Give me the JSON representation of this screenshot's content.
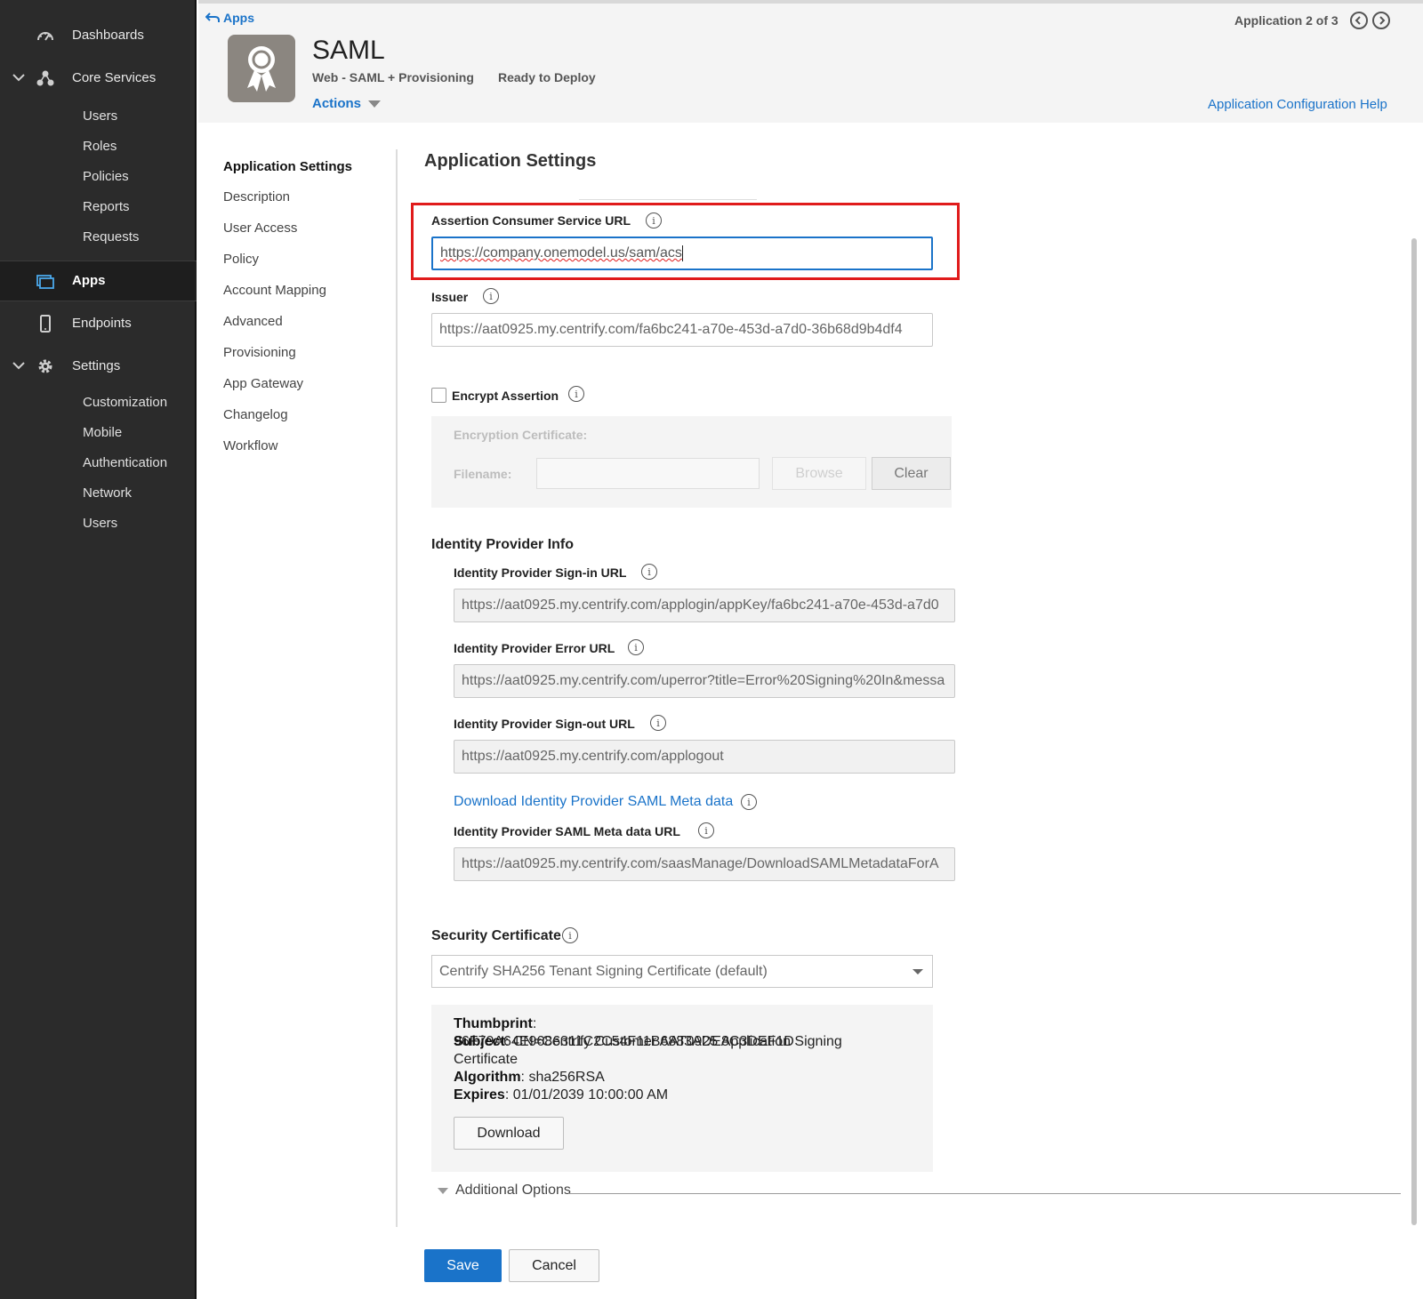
{
  "sidebar": {
    "dashboards": "Dashboards",
    "core_services": "Core Services",
    "core_items": [
      "Users",
      "Roles",
      "Policies",
      "Reports",
      "Requests"
    ],
    "apps": "Apps",
    "endpoints": "Endpoints",
    "settings": "Settings",
    "settings_items": [
      "Customization",
      "Mobile",
      "Authentication",
      "Network",
      "Users"
    ]
  },
  "header": {
    "back_label": "Apps",
    "app_name": "SAML",
    "app_type": "Web - SAML + Provisioning",
    "status": "Ready to Deploy",
    "actions_label": "Actions",
    "counter": "Application 2 of 3",
    "config_help": "Application Configuration Help"
  },
  "section_nav": [
    "Application Settings",
    "Description",
    "User Access",
    "Policy",
    "Account Mapping",
    "Advanced",
    "Provisioning",
    "App Gateway",
    "Changelog",
    "Workflow"
  ],
  "form": {
    "title": "Application Settings",
    "acs_label": "Assertion Consumer Service URL",
    "acs_value": "https://company.onemodel.us/sam/acs",
    "issuer_label": "Issuer",
    "issuer_value": "https://aat0925.my.centrify.com/fa6bc241-a70e-453d-a7d0-36b68d9b4df4",
    "encrypt_label": "Encrypt Assertion",
    "encrypt_checked": false,
    "enc_cert_label": "Encryption Certificate:",
    "filename_label": "Filename:",
    "browse_label": "Browse",
    "clear_label": "Clear",
    "idp_heading": "Identity Provider Info",
    "signin_label": "Identity Provider Sign-in URL",
    "signin_value": "https://aat0925.my.centrify.com/applogin/appKey/fa6bc241-a70e-453d-a7d0",
    "error_label": "Identity Provider Error URL",
    "error_value": "https://aat0925.my.centrify.com/uperror?title=Error%20Signing%20In&messa",
    "signout_label": "Identity Provider Sign-out URL",
    "signout_value": "https://aat0925.my.centrify.com/applogout",
    "download_meta_link": "Download Identity Provider SAML Meta data",
    "meta_url_label": "Identity Provider SAML Meta data URL",
    "meta_url_value": "https://aat0925.my.centrify.com/saasManage/DownloadSAMLMetadataForA",
    "cert_heading": "Security Certificate",
    "cert_select": "Centrify SHA256 Tenant Signing Certificate (default)",
    "thumbprint_label": "Thumbprint",
    "thumbprint_value": "96F79A64E9686311C2C54F11B6883ADE8C3DEF1D",
    "subject_label": "Subject",
    "subject_value": "CN=Centrify Customer AAT0925 Application Signing Certificate",
    "algorithm_label": "Algorithm",
    "algorithm_value": "sha256RSA",
    "expires_label": "Expires",
    "expires_value": "01/01/2039 10:00:00 AM",
    "download_button": "Download",
    "additional_options": "Additional Options",
    "save_button": "Save",
    "cancel_button": "Cancel"
  },
  "icons": {
    "info": "i",
    "colors": {
      "accent": "#1a73c9",
      "sidebar_bg": "#2b2b2b",
      "highlight": "#e01b1b",
      "logo_bg": "#8b8680"
    }
  }
}
